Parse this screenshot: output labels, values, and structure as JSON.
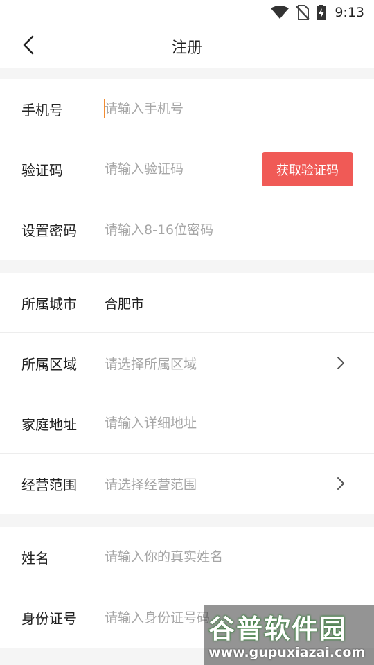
{
  "status_bar": {
    "time": "9:13",
    "icons": [
      "wifi-icon",
      "no-sim-icon",
      "battery-charging-icon"
    ]
  },
  "header": {
    "title": "注册",
    "back_icon": "chevron-left-icon"
  },
  "form": {
    "account": {
      "phone": {
        "label": "手机号",
        "placeholder": "请输入手机号"
      },
      "code": {
        "label": "验证码",
        "placeholder": "请输入验证码",
        "button_label": "获取验证码"
      },
      "password": {
        "label": "设置密码",
        "placeholder": "请输入8-16位密码"
      }
    },
    "location": {
      "city": {
        "label": "所属城市",
        "value": "合肥市"
      },
      "region": {
        "label": "所属区域",
        "placeholder": "请选择所属区域",
        "icon": "chevron-right-icon"
      },
      "address": {
        "label": "家庭地址",
        "placeholder": "请输入详细地址"
      },
      "business_scope": {
        "label": "经营范围",
        "placeholder": "请选择经营范围",
        "icon": "chevron-right-icon"
      }
    },
    "identity": {
      "name": {
        "label": "姓名",
        "placeholder": "请输入你的真实姓名"
      },
      "id_number": {
        "label": "身份证号",
        "placeholder": "请输入身份证号码"
      }
    }
  },
  "watermark": {
    "title": "谷普软件园",
    "url": "www.gupuxiazai.com"
  },
  "colors": {
    "accent_button": "#f05a56",
    "caret": "#f28b30",
    "placeholder": "#a6a6a6",
    "background": "#f5f5f5"
  }
}
